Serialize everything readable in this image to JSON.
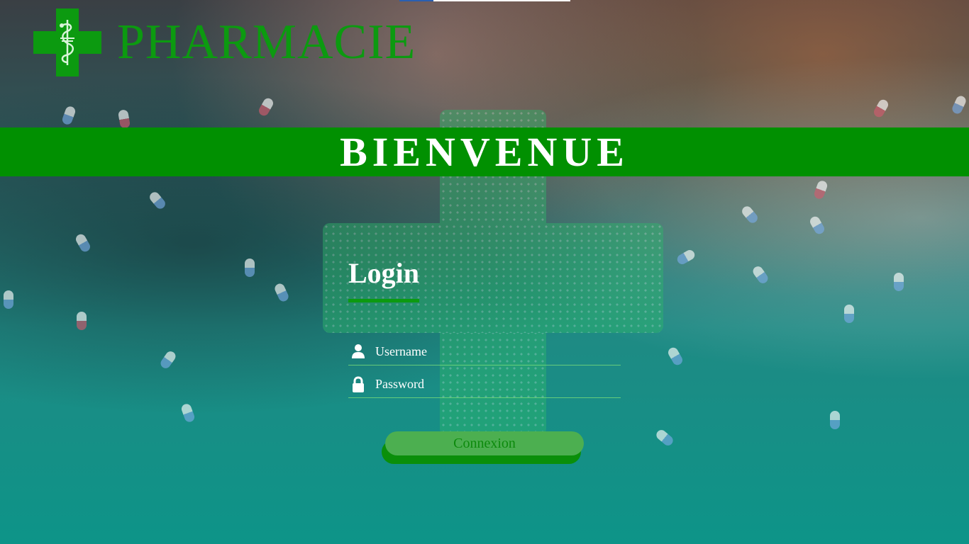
{
  "brand": {
    "name": "PHARMACIE",
    "logo_icon": "pharmacy-cross-icon",
    "color": "#0c9a10"
  },
  "banner": {
    "title": "BIENVENUE",
    "color": "#019001"
  },
  "login": {
    "heading": "Login",
    "username": {
      "placeholder": "Username",
      "icon": "user-icon"
    },
    "password": {
      "placeholder": "Password",
      "icon": "lock-icon"
    },
    "submit_label": "Connexion"
  }
}
